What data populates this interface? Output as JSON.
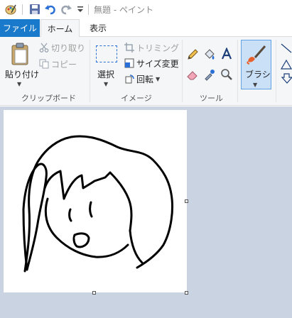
{
  "window": {
    "title": "無題 - ペイント"
  },
  "tabs": {
    "file": "ファイル",
    "home": "ホーム",
    "view": "表示"
  },
  "clipboard": {
    "paste_label": "貼り付け",
    "cut_label": "切り取り",
    "copy_label": "コピー",
    "group_label": "クリップボード"
  },
  "image": {
    "select_label": "選択",
    "crop_label": "トリミング",
    "resize_label": "サイズ変更",
    "rotate_label": "回転",
    "group_label": "イメージ"
  },
  "tools": {
    "group_label": "ツール"
  },
  "brushes": {
    "label": "ブラシ"
  },
  "colors": {
    "accent": "#1979ca",
    "brush_selected": "#c9e0f7",
    "workspace": "#c9d3e2"
  }
}
